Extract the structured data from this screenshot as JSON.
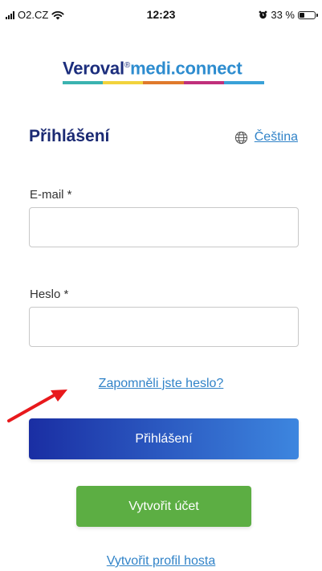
{
  "status_bar": {
    "carrier": "O2.CZ",
    "time": "12:23",
    "battery": "33 %",
    "battery_level": 0.33,
    "icons": [
      "signal-icon",
      "wifi-icon",
      "alarm-icon",
      "battery-icon"
    ]
  },
  "logo": {
    "brand": "Veroval",
    "registered": "®",
    "product": "medi.connect",
    "bar_colors": [
      "#3bb3b0",
      "#f2d33c",
      "#e07a2b",
      "#c0307b",
      "#3aa1d8"
    ]
  },
  "login": {
    "title": "Přihlášení",
    "language_label": "Čeština",
    "language_icon": "globe-icon",
    "email_label": "E-mail *",
    "email_value": "",
    "password_label": "Heslo *",
    "password_value": "",
    "forgot_password": "Zapomněli jste heslo?",
    "submit_label": "Přihlášení",
    "create_account_label": "Vytvořit účet",
    "guest_profile_label": "Vytvořit profil hosta"
  },
  "colors": {
    "title": "#1b2a73",
    "link": "#3183c8",
    "login_gradient_start": "#1a2ea3",
    "login_gradient_end": "#3d86df",
    "create_button": "#5cae43",
    "annotation_arrow": "#e8191c"
  }
}
